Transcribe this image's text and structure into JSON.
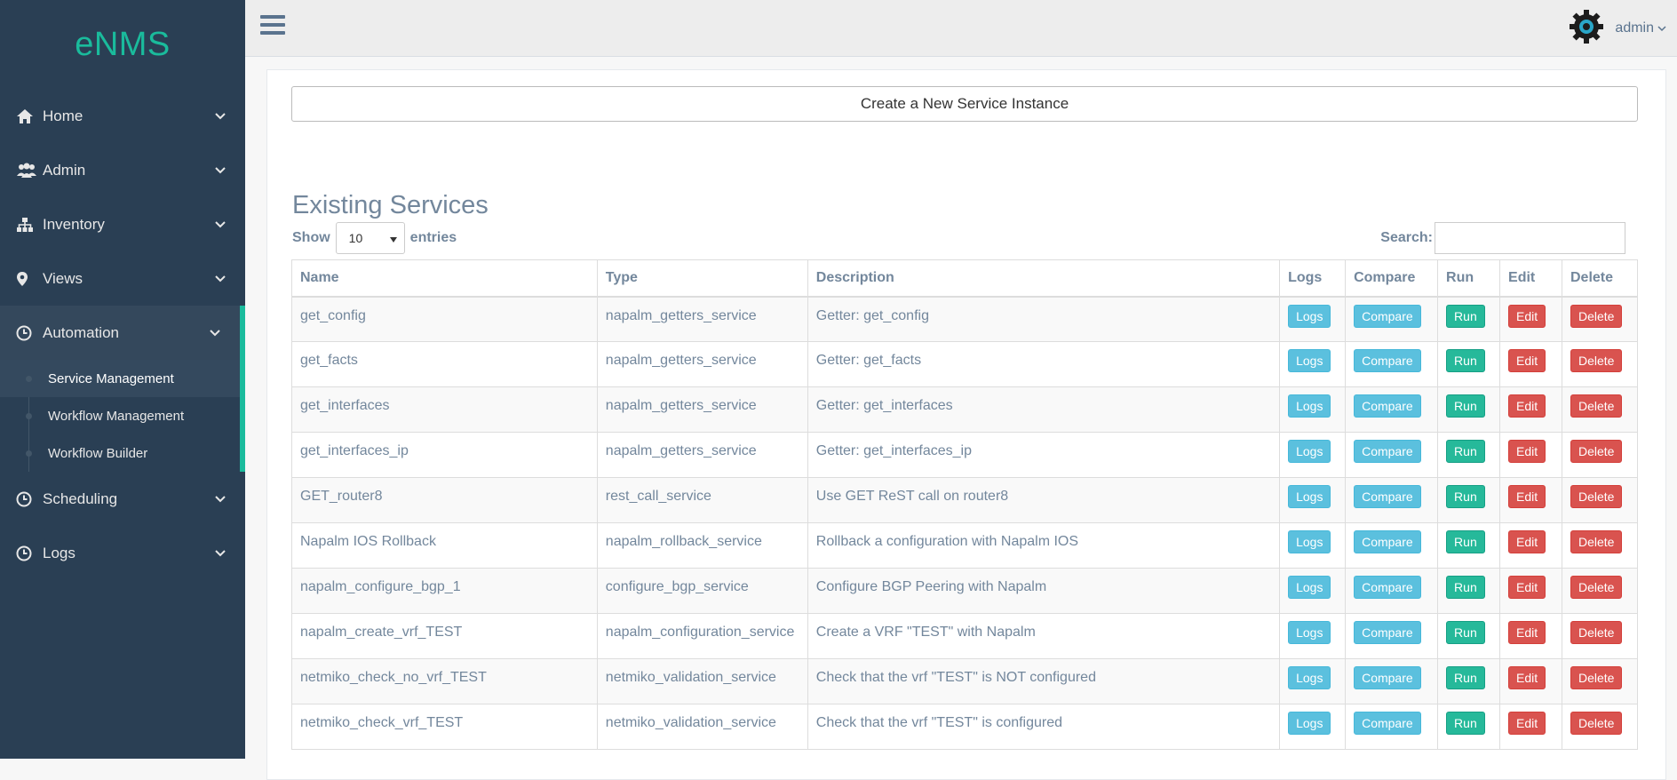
{
  "app": {
    "brand": "eNMS"
  },
  "sidebar": {
    "menu": [
      {
        "label": "Home",
        "icon": "home-icon"
      },
      {
        "label": "Admin",
        "icon": "users-icon"
      },
      {
        "label": "Inventory",
        "icon": "sitemap-icon"
      },
      {
        "label": "Views",
        "icon": "map-marker-icon"
      },
      {
        "label": "Automation",
        "icon": "clock-icon",
        "active": true
      },
      {
        "label": "Scheduling",
        "icon": "clock-icon"
      },
      {
        "label": "Logs",
        "icon": "clock-icon"
      }
    ],
    "automation_sub": [
      {
        "label": "Service Management",
        "current": true
      },
      {
        "label": "Workflow Management"
      },
      {
        "label": "Workflow Builder"
      }
    ]
  },
  "topnav": {
    "user": "admin"
  },
  "main": {
    "create_button": "Create a New Service Instance",
    "section_title": "Existing Services",
    "show_label": "Show",
    "entries_value": "10",
    "entries_label": "entries",
    "search_label": "Search:",
    "search_value": "",
    "columns": [
      "Name",
      "Type",
      "Description",
      "Logs",
      "Compare",
      "Run",
      "Edit",
      "Delete"
    ],
    "button_labels": {
      "logs": "Logs",
      "compare": "Compare",
      "run": "Run",
      "edit": "Edit",
      "delete": "Delete"
    },
    "rows": [
      {
        "name": "get_config",
        "type": "napalm_getters_service",
        "description": "Getter: get_config"
      },
      {
        "name": "get_facts",
        "type": "napalm_getters_service",
        "description": "Getter: get_facts"
      },
      {
        "name": "get_interfaces",
        "type": "napalm_getters_service",
        "description": "Getter: get_interfaces"
      },
      {
        "name": "get_interfaces_ip",
        "type": "napalm_getters_service",
        "description": "Getter: get_interfaces_ip"
      },
      {
        "name": "GET_router8",
        "type": "rest_call_service",
        "description": "Use GET ReST call on router8"
      },
      {
        "name": "Napalm IOS Rollback",
        "type": "napalm_rollback_service",
        "description": "Rollback a configuration with Napalm IOS"
      },
      {
        "name": "napalm_configure_bgp_1",
        "type": "configure_bgp_service",
        "description": "Configure BGP Peering with Napalm"
      },
      {
        "name": "napalm_create_vrf_TEST",
        "type": "napalm_configuration_service",
        "description": "Create a VRF \"TEST\" with Napalm"
      },
      {
        "name": "netmiko_check_no_vrf_TEST",
        "type": "netmiko_validation_service",
        "description": "Check that the vrf \"TEST\" is NOT configured"
      },
      {
        "name": "netmiko_check_vrf_TEST",
        "type": "netmiko_validation_service",
        "description": "Check that the vrf \"TEST\" is configured"
      }
    ]
  },
  "colors": {
    "sidebar_bg": "#2a3f54",
    "accent": "#1abb9c",
    "info": "#5bc0de",
    "success": "#26b99a",
    "danger": "#d9534f"
  }
}
